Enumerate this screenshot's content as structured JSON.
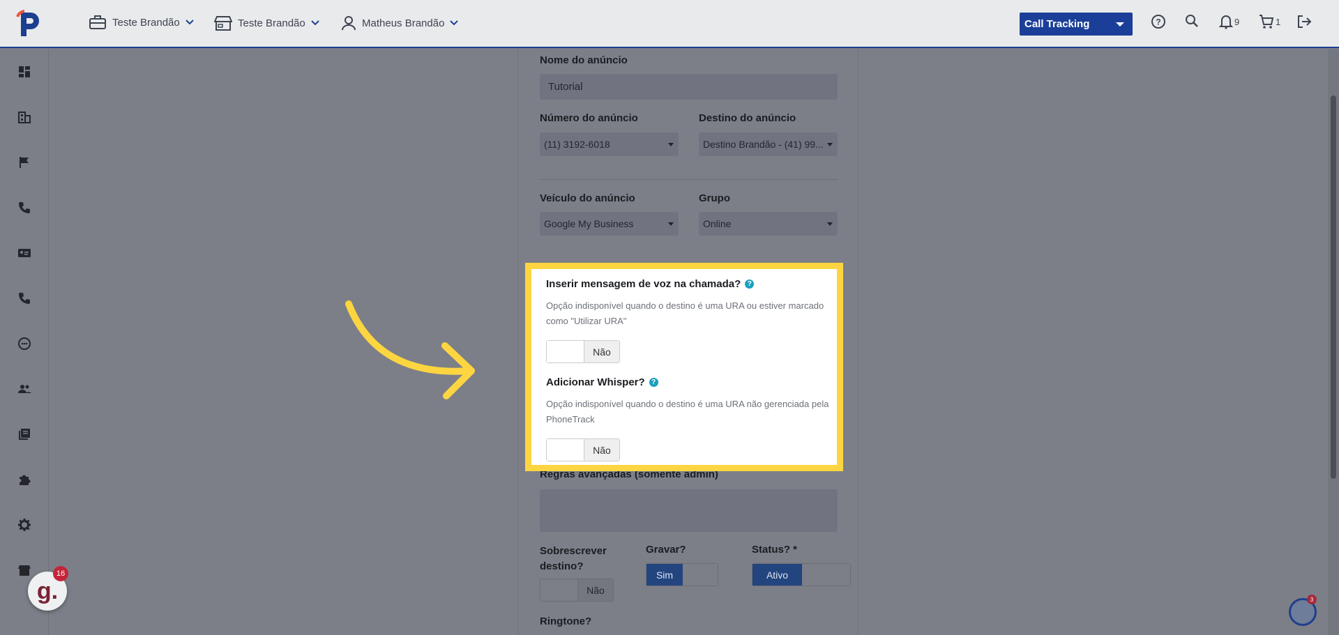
{
  "header": {
    "company_1": "Teste Brandão",
    "company_2": "Teste Brandão",
    "user": "Matheus Brandão",
    "product_select": "Call Tracking",
    "notifications_count": "9",
    "cart_count": "1"
  },
  "form": {
    "name_label": "Nome do anúncio",
    "name_value": "Tutorial",
    "number_label": "Número do anúncio",
    "number_value": "(11) 3192-6018",
    "destination_label": "Destino do anúncio",
    "destination_value": "Destino Brandão - (41) 99...",
    "vehicle_label": "Veículo do anúncio",
    "vehicle_value": "Google My Business",
    "group_label": "Grupo",
    "group_value": "Online",
    "voice_message_title": "Inserir mensagem de voz na chamada?",
    "voice_message_desc": "Opção indisponível quando o destino é uma URA ou estiver marcado como \"Utilizar URA\"",
    "voice_message_toggle": "Não",
    "whisper_title": "Adicionar Whisper?",
    "whisper_desc": "Opção indisponível quando o destino é uma URA não gerenciada pela PhoneTrack",
    "whisper_toggle": "Não",
    "advanced_rules_label": "Regras avançadas (somente admin)",
    "overwrite_label": "Sobrescrever destino?",
    "overwrite_toggle": "Não",
    "record_label": "Gravar?",
    "record_toggle": "Sim",
    "status_label": "Status? *",
    "status_toggle": "Ativo",
    "ringtone_label": "Ringtone?"
  },
  "widgets": {
    "g_badge_letter": "g.",
    "g_badge_count": "16",
    "chat_count": "3"
  },
  "colors": {
    "accent": "#1b3f99",
    "highlight": "#fcd541",
    "help": "#1ba0be"
  }
}
